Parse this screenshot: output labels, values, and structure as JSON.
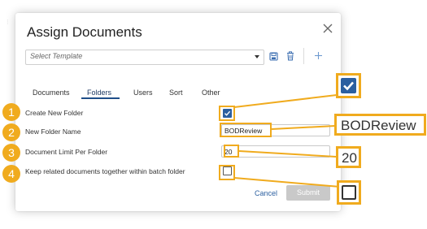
{
  "dialog": {
    "title": "Assign Documents",
    "template_placeholder": "Select Template",
    "icons": [
      "close-icon",
      "save-icon",
      "trash-icon",
      "plus-icon",
      "caret-down-icon"
    ]
  },
  "tabs": [
    {
      "label": "Documents"
    },
    {
      "label": "Folders",
      "active": true
    },
    {
      "label": "Users"
    },
    {
      "label": "Sort"
    },
    {
      "label": "Other"
    }
  ],
  "fields": {
    "create_new_folder": {
      "label": "Create New Folder",
      "checked": true
    },
    "new_folder_name": {
      "label": "New Folder Name",
      "value": "BODReview"
    },
    "document_limit": {
      "label": "Document Limit Per Folder",
      "value": "20"
    },
    "keep_together": {
      "label": "Keep related documents together within batch folder",
      "checked": false
    }
  },
  "buttons": {
    "cancel": "Cancel",
    "submit": "Submit"
  },
  "callouts": {
    "badges": [
      "1",
      "2",
      "3",
      "4"
    ],
    "zoom_folder_name": "BODReview",
    "zoom_limit": "20"
  },
  "colors": {
    "accent": "#f0ab1e",
    "primary": "#2b5fa0",
    "disabled": "#c9c9c9"
  }
}
